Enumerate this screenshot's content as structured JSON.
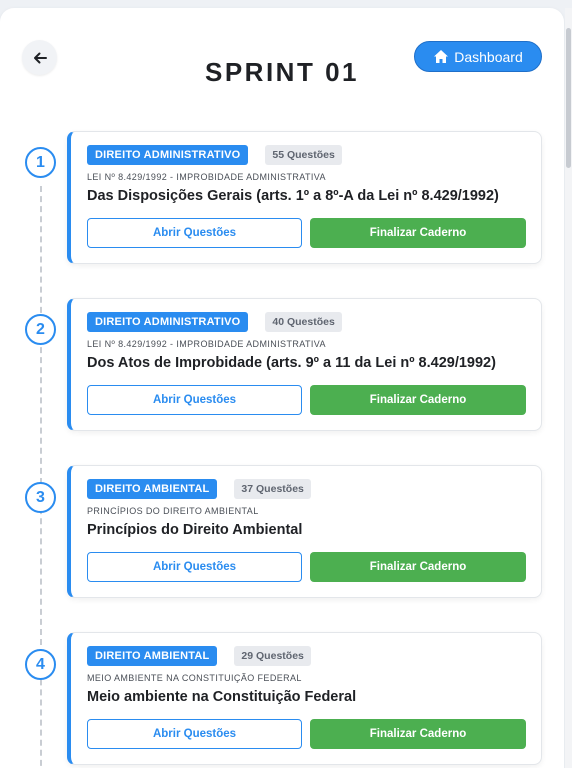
{
  "header": {
    "title": "SPRINT 01",
    "dashboard_label": "Dashboard"
  },
  "steps": [
    {
      "number": "1",
      "subject": "DIREITO ADMINISTRATIVO",
      "count": "55 Questões",
      "subtitle": "LEI Nº 8.429/1992 - IMPROBIDADE ADMINISTRATIVA",
      "title": "Das Disposições Gerais (arts. 1º a 8º-A da Lei nº 8.429/1992)",
      "open_label": "Abrir Questões",
      "finish_label": "Finalizar Caderno"
    },
    {
      "number": "2",
      "subject": "DIREITO ADMINISTRATIVO",
      "count": "40 Questões",
      "subtitle": "LEI Nº 8.429/1992 - IMPROBIDADE ADMINISTRATIVA",
      "title": "Dos Atos de Improbidade (arts. 9º a 11 da Lei nº 8.429/1992)",
      "open_label": "Abrir Questões",
      "finish_label": "Finalizar Caderno"
    },
    {
      "number": "3",
      "subject": "DIREITO AMBIENTAL",
      "count": "37 Questões",
      "subtitle": "PRINCÍPIOS DO DIREITO AMBIENTAL",
      "title": "Princípios do Direito Ambiental",
      "open_label": "Abrir Questões",
      "finish_label": "Finalizar Caderno"
    },
    {
      "number": "4",
      "subject": "DIREITO AMBIENTAL",
      "count": "29 Questões",
      "subtitle": "MEIO AMBIENTE NA CONSTITUIÇÃO FEDERAL",
      "title": "Meio ambiente na Constituição Federal",
      "open_label": "Abrir Questões",
      "finish_label": "Finalizar Caderno"
    }
  ],
  "colors": {
    "accent": "#2a8cf0",
    "success": "#4caf50",
    "title_text": "#1f2125"
  },
  "icons": {
    "back": "arrow-left-icon",
    "dashboard": "home-icon"
  }
}
